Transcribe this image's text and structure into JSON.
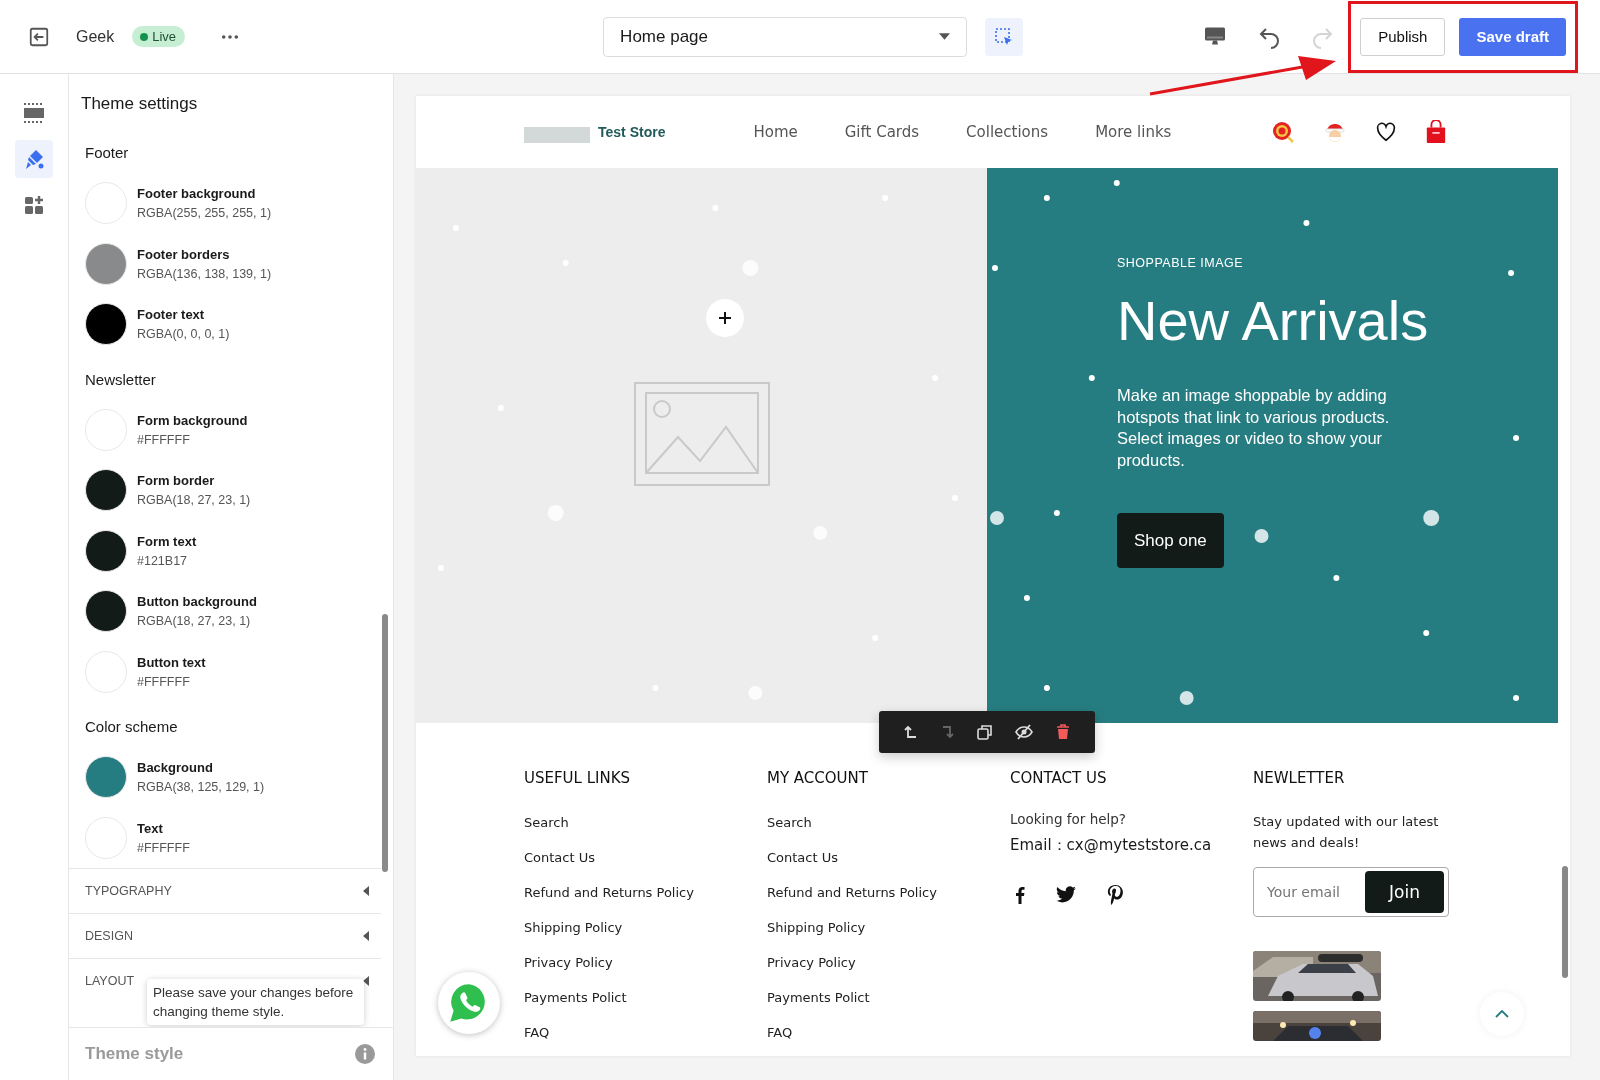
{
  "topbar": {
    "theme_name": "Geek",
    "status": "Live",
    "page_select": "Home page",
    "publish": "Publish",
    "save_draft": "Save draft",
    "redo_disabled": true
  },
  "rail": [
    {
      "selected": false
    },
    {
      "selected": true
    },
    {
      "selected": false
    }
  ],
  "panel": {
    "title": "Theme settings",
    "groups": [
      {
        "title": "Footer",
        "items": [
          {
            "name": "Footer background",
            "value": "RGBA(255, 255, 255, 1)",
            "color": "#ffffff"
          },
          {
            "name": "Footer borders",
            "value": "RGBA(136, 138, 139, 1)",
            "color": "#888a8b"
          },
          {
            "name": "Footer text",
            "value": "RGBA(0, 0, 0, 1)",
            "color": "#000000"
          }
        ]
      },
      {
        "title": "Newsletter",
        "items": [
          {
            "name": "Form background",
            "value": "#FFFFFF",
            "color": "#ffffff"
          },
          {
            "name": "Form border",
            "value": "RGBA(18, 27, 23, 1)",
            "color": "#121b17"
          },
          {
            "name": "Form text",
            "value": "#121B17",
            "color": "#121b17"
          },
          {
            "name": "Button background",
            "value": "RGBA(18, 27, 23, 1)",
            "color": "#121b17"
          },
          {
            "name": "Button text",
            "value": "#FFFFFF",
            "color": "#ffffff"
          }
        ]
      },
      {
        "title": "Color scheme",
        "items": [
          {
            "name": "Background",
            "value": "RGBA(38, 125, 129, 1)",
            "color": "#267d81"
          },
          {
            "name": "Text",
            "value": "#FFFFFF",
            "color": "#ffffff"
          }
        ]
      }
    ],
    "sections": [
      {
        "label": "TYPOGRAPHY",
        "expanded": false
      },
      {
        "label": "DESIGN",
        "expanded": false
      },
      {
        "label": "LAYOUT",
        "expanded": false
      }
    ],
    "tooltip": "Please save your changes before changing theme style.",
    "theme_style": "Theme style"
  },
  "store": {
    "name": "Test Store",
    "nav": [
      "Home",
      "Gift Cards",
      "Collections",
      "More links"
    ],
    "hero": {
      "eyebrow": "SHOPPABLE IMAGE",
      "title": "New Arrivals",
      "text": "Make an image shoppable by adding hotspots that link to various products. Select images or video to show your products.",
      "button": "Shop one"
    },
    "footer": {
      "link_columns": [
        {
          "title": "USEFUL LINKS",
          "links": [
            "Search",
            "Contact Us",
            "Refund and Returns Policy",
            "Shipping Policy",
            "Privacy Policy",
            "Payments Polict",
            "FAQ"
          ]
        },
        {
          "title": "MY ACCOUNT",
          "links": [
            "Search",
            "Contact Us",
            "Refund and Returns Policy",
            "Shipping Policy",
            "Privacy Policy",
            "Payments Polict",
            "FAQ"
          ]
        }
      ],
      "contact": {
        "title": "CONTACT US",
        "help": "Looking for help?",
        "email": "Email：cx@myteststore.ca"
      },
      "newsletter": {
        "title": "NEWLETTER",
        "text": "Stay updated with our latest news and deals!",
        "placeholder": "Your email",
        "button": "Join"
      }
    }
  }
}
